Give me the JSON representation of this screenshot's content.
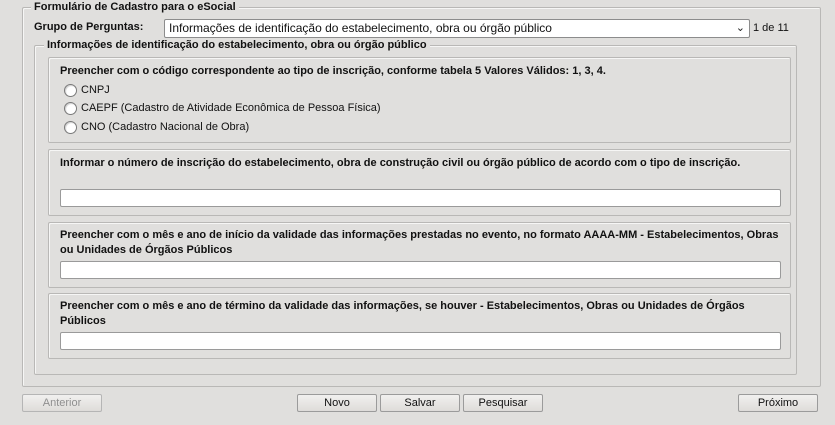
{
  "form": {
    "title": "Formulário de Cadastro para o eSocial",
    "grupo_label": "Grupo de Perguntas:",
    "grupo_selected": "Informações de identificação do estabelecimento, obra ou órgão público",
    "page_indicator": "1 de 11",
    "section_title": "Informações de identificação do estabelecimento, obra ou órgão público"
  },
  "questions": {
    "q1": {
      "text": "Preencher com o código correspondente ao tipo de inscrição, conforme tabela 5 Valores Válidos: 1, 3, 4.",
      "options": [
        "CNPJ",
        "CAEPF (Cadastro de Atividade Econômica de Pessoa Física)",
        "CNO (Cadastro Nacional de Obra)"
      ]
    },
    "q2": {
      "text": "Informar o número de inscrição do estabelecimento, obra de construção civil ou órgão público de acordo com o tipo de inscrição.",
      "value": ""
    },
    "q3": {
      "text": "Preencher com o mês e ano de início da validade das informações prestadas no evento, no formato AAAA-MM - Estabelecimentos, Obras ou Unidades de Órgãos Públicos",
      "value": ""
    },
    "q4": {
      "text": "Preencher com o mês e ano de término da validade das informações, se houver - Estabelecimentos, Obras ou Unidades de Órgãos Públicos",
      "value": ""
    }
  },
  "buttons": {
    "anterior": "Anterior",
    "novo": "Novo",
    "salvar": "Salvar",
    "pesquisar": "Pesquisar",
    "proximo": "Próximo"
  }
}
